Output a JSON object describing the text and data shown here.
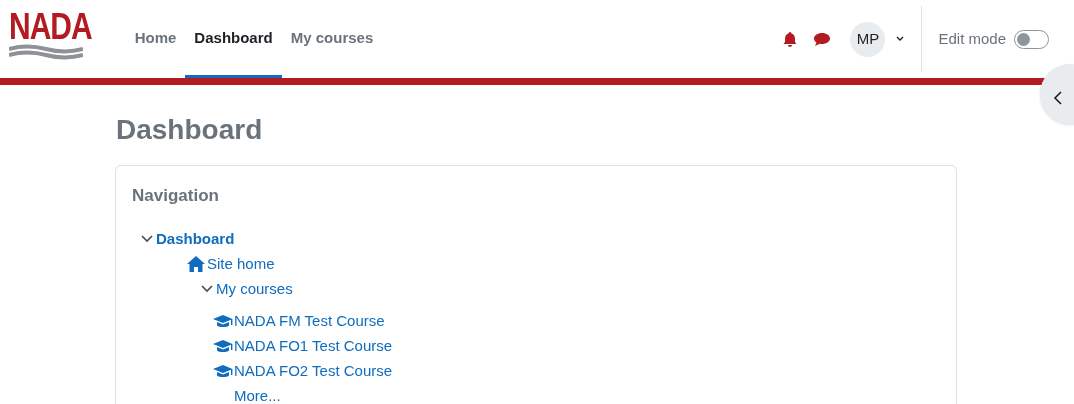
{
  "header": {
    "logo": "NADA",
    "nav": [
      {
        "label": "Home",
        "selected": false
      },
      {
        "label": "Dashboard",
        "selected": true
      },
      {
        "label": "My courses",
        "selected": false
      }
    ],
    "user_initials": "MP",
    "edit_mode": {
      "label": "Edit mode",
      "on": false
    }
  },
  "page_title": "Dashboard",
  "navigation_block": {
    "title": "Navigation",
    "tree": [
      {
        "label": "Dashboard",
        "kind": "branch",
        "expanded": true,
        "children": [
          {
            "label": "Site home",
            "kind": "home"
          },
          {
            "label": "My courses",
            "kind": "branch",
            "expanded": true,
            "children": [
              {
                "label": "NADA FM Test Course",
                "kind": "course"
              },
              {
                "label": "NADA FO1 Test Course",
                "kind": "course"
              },
              {
                "label": "NADA FO2 Test Course",
                "kind": "course"
              },
              {
                "label": "More...",
                "kind": "link"
              }
            ]
          }
        ]
      }
    ]
  }
}
